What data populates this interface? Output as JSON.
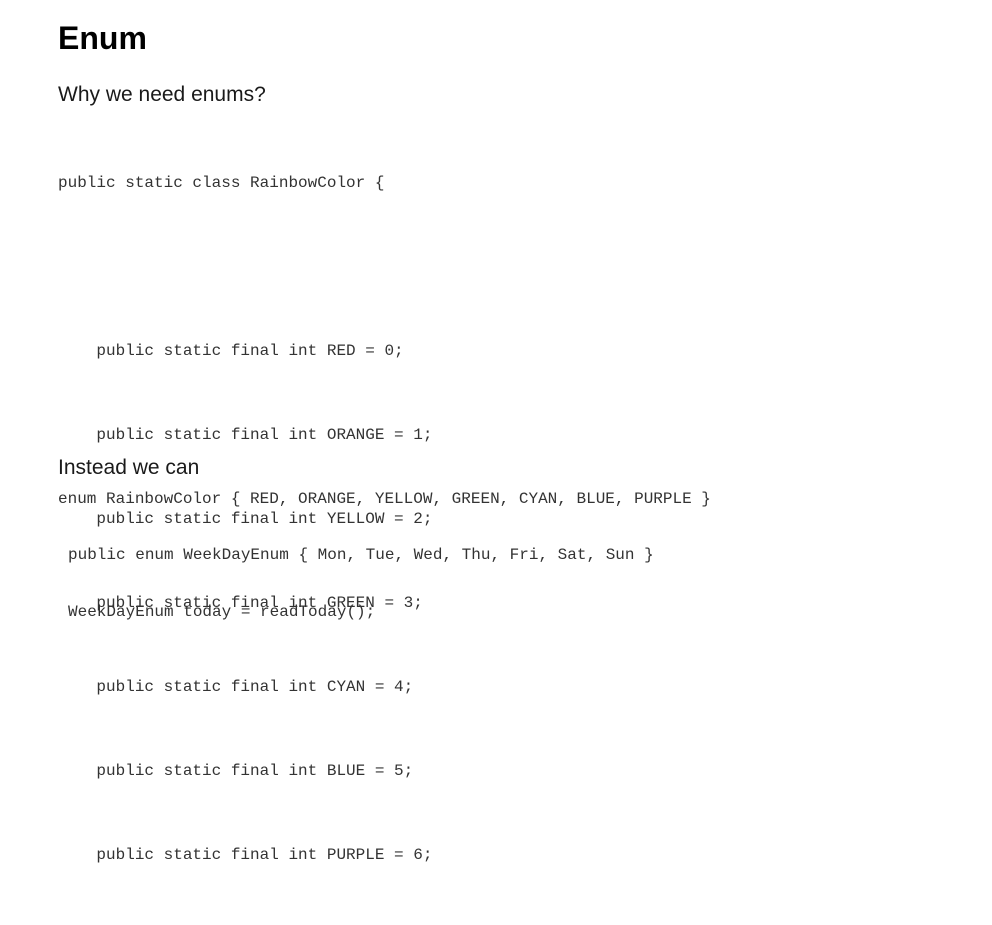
{
  "page": {
    "title": "Enum",
    "section_why": {
      "heading": "Why we need enums?",
      "code_lines": [
        "public static class RainbowColor {",
        "",
        "    public static final int RED = 0;",
        "    public static final int ORANGE = 1;",
        "    public static final int YELLOW = 2;",
        "    public static final int GREEN = 3;",
        "    public static final int CYAN = 4;",
        "    public static final int BLUE = 5;",
        "    public static final int PURPLE = 6;"
      ]
    },
    "section_instead": {
      "heading": "Instead we can",
      "code_enum": "enum RainbowColor { RED, ORANGE, YELLOW, GREEN, CYAN, BLUE, PURPLE }",
      "code_weekday": "public enum WeekDayEnum { Mon, Tue, Wed, Thu, Fri, Sat, Sun }",
      "code_today": "WeekDayEnum today = readToday();"
    }
  }
}
